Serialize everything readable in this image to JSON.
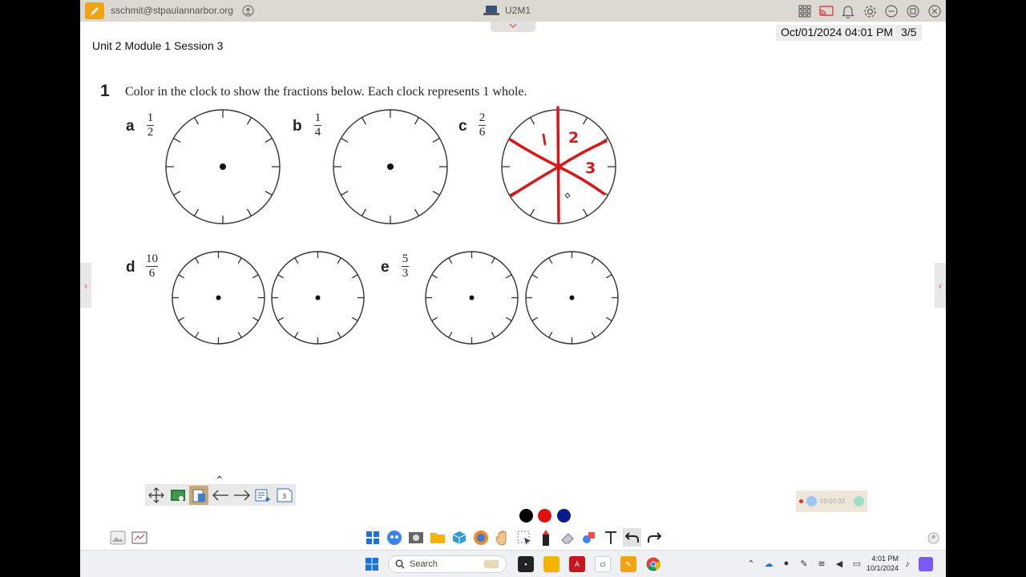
{
  "titlebar": {
    "user_email": "sschmit@stpaulannarbor.org",
    "app_title": "U2M1"
  },
  "header": {
    "session_title": "Unit 2 Module 1 Session 3",
    "datetime": "Oct/01/2024  04:01 PM",
    "page_indicator": "3/5"
  },
  "problem": {
    "number": "1",
    "text": "Color in the clock to show the fractions below. Each clock represents 1 whole.",
    "parts": [
      {
        "letter": "a",
        "numerator": "1",
        "denominator": "2"
      },
      {
        "letter": "b",
        "numerator": "1",
        "denominator": "4"
      },
      {
        "letter": "c",
        "numerator": "2",
        "denominator": "6"
      },
      {
        "letter": "d",
        "numerator": "10",
        "denominator": "6"
      },
      {
        "letter": "e",
        "numerator": "5",
        "denominator": "3"
      }
    ],
    "annotations": [
      "1",
      "2",
      "3"
    ]
  },
  "recorder": {
    "time": "00:00:33"
  },
  "float_toolbar": {
    "page_badge": "3"
  },
  "colors": {
    "black": "#000000",
    "red": "#e01010",
    "navy": "#0a1c8c",
    "ink": "#d81818"
  },
  "taskbar": {
    "search_placeholder": "Search",
    "time": "4:01 PM",
    "date": "10/1/2024"
  }
}
